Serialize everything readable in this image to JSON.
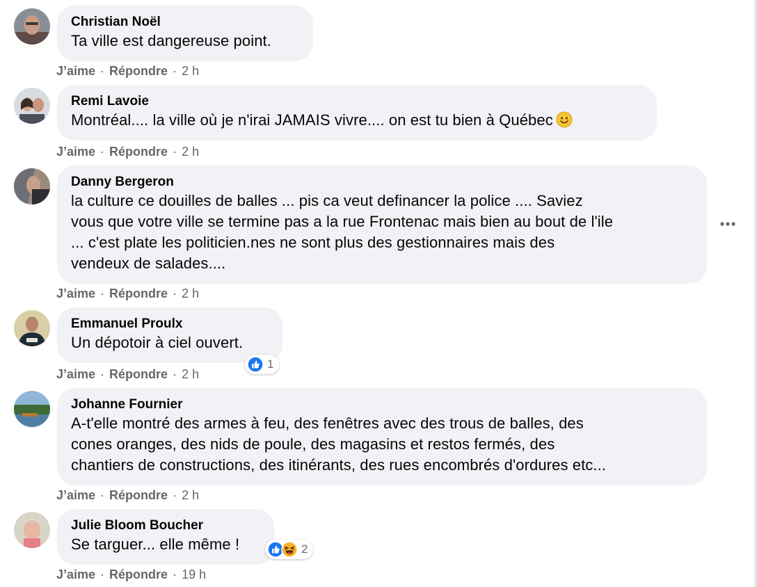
{
  "actions": {
    "like": "J’aime",
    "reply": "Répondre",
    "separator": "·"
  },
  "comments": [
    {
      "author": "Christian Noël",
      "lines": [
        "Ta ville est dangereuse point."
      ],
      "time": "2 h"
    },
    {
      "author": "Remi Lavoie",
      "lines": [
        "Montréal.... la ville où je n'irai JAMAIS vivre.... on est tu bien à Québec"
      ],
      "emoji": "slightly-smiling-face-icon",
      "time": "2 h"
    },
    {
      "author": "Danny Bergeron",
      "lines": [
        "la culture ce douilles de balles ... pis ca veut definancer la police .... Saviez",
        "vous que votre ville se termine pas a la rue Frontenac mais bien au bout de l'ile",
        "... c'est plate les politicien.nes ne sont plus des gestionnaires mais des",
        "vendeux de salades...."
      ],
      "time": "2 h"
    },
    {
      "author": "Emmanuel Proulx",
      "lines": [
        "Un dépotoir à ciel ouvert."
      ],
      "time": "2 h",
      "reactions": {
        "icons": [
          "like-reaction-icon"
        ],
        "count": "1"
      }
    },
    {
      "author": "Johanne Fournier",
      "lines": [
        "A-t'elle montré des armes à feu, des fenêtres avec des trous de balles, des",
        "cones oranges, des nids de poule, des magasins et restos fermés, des",
        "chantiers de constructions, des itinérants, des rues encombrés d'ordures etc..."
      ],
      "time": "2 h"
    },
    {
      "author": "Julie Bloom Boucher",
      "lines": [
        "Se targuer... elle même !"
      ],
      "time": "19 h",
      "reactions": {
        "icons": [
          "like-reaction-icon",
          "haha-reaction-icon"
        ],
        "count": "2"
      }
    }
  ],
  "more_options_icon": "more-horizontal-icon",
  "colors": {
    "bubble": "#f0f2f5",
    "secondary_text": "#65676b",
    "like_blue": "#1877f2"
  }
}
